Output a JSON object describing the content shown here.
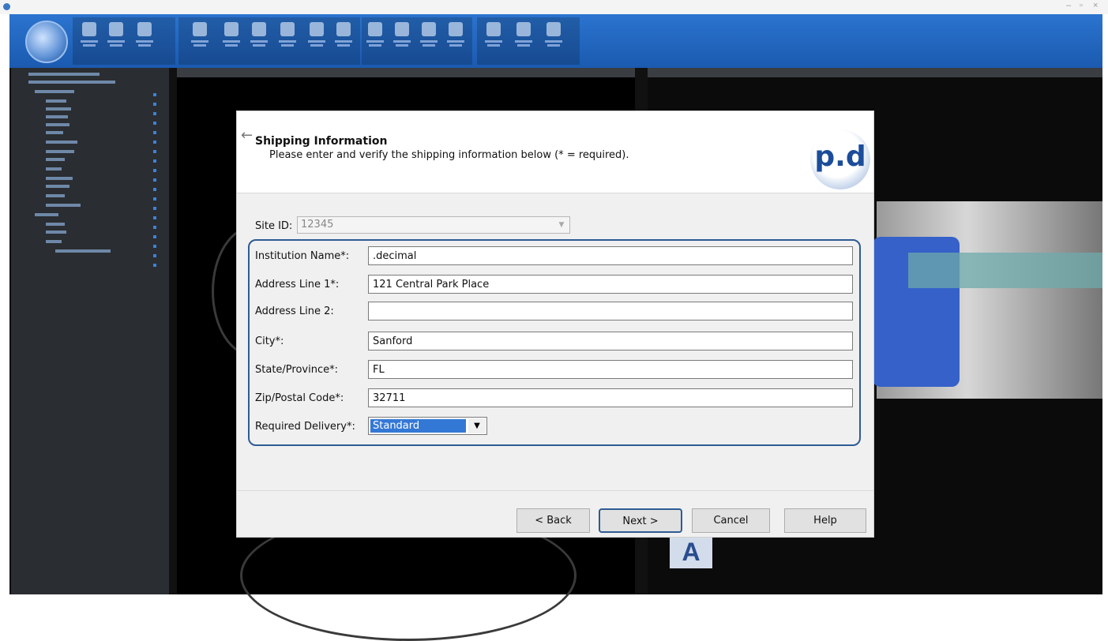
{
  "dialog": {
    "title": "Shipping Information",
    "subtitle": "Please enter and verify the shipping information below (* = required).",
    "logo_text": "p.d",
    "site_id": {
      "label": "Site ID:",
      "value": "12345"
    },
    "fields": [
      {
        "label": "Institution Name*:",
        "value": ".decimal"
      },
      {
        "label": "Address Line 1*:",
        "value": "121 Central Park Place"
      },
      {
        "label": "Address Line 2:",
        "value": ""
      },
      {
        "label": "City*:",
        "value": "Sanford"
      },
      {
        "label": "State/Province*:",
        "value": "FL"
      },
      {
        "label": "Zip/Postal Code*:",
        "value": "32711"
      }
    ],
    "delivery": {
      "label": "Required Delivery*:",
      "value": "Standard"
    },
    "buttons": {
      "back": "< Back",
      "next": "Next >",
      "cancel": "Cancel",
      "help": "Help"
    }
  },
  "viewport": {
    "orientation_label": "A"
  },
  "icons": {
    "back": "back-arrow-icon",
    "dropdown": "chevron-down-icon",
    "logo": "pd-logo"
  },
  "colors": {
    "ribbon": "#1f62b9",
    "focus_frame": "#2e5b93",
    "selection": "#3478d6"
  }
}
